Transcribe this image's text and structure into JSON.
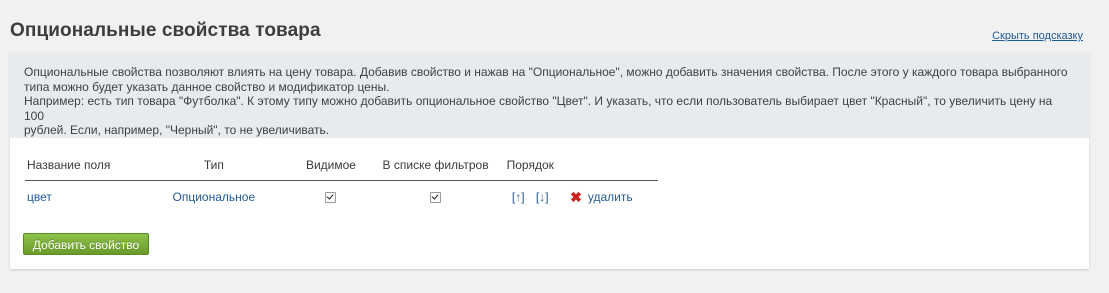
{
  "header": {
    "title": "Опциональные свойства товара",
    "hide_hint": "Скрыть подсказку"
  },
  "hint": {
    "line1": "Опциональные свойства позволяют влиять на цену товара. Добавив свойство и нажав на \"Опциональное\", можно добавить значения свойства. После этого у каждого товара выбранного",
    "line2": "типа можно будет указать данное свойство и модификатор цены.",
    "line3": "Например: есть тип товара \"Футболка\". К этому типу можно добавить опциональное свойство \"Цвет\". И указать, что если пользователь выбирает цвет \"Красный\", то увеличить цену на 100",
    "line4": "рублей. Если, например, \"Черный\", то не увеличивать."
  },
  "table": {
    "columns": [
      "Название поля",
      "Тип",
      "Видимое",
      "В списке фильтров",
      "Порядок"
    ],
    "rows": [
      {
        "name": "цвет",
        "type": "Опциональное",
        "visible": true,
        "in_filters": true,
        "order_up": "[↑]",
        "order_down": "[↓]",
        "delete": "удалить"
      }
    ]
  },
  "actions": {
    "add_property": "Добавить свойство"
  },
  "icons": {
    "delete": "close-icon",
    "checkbox": "checkbox-checked"
  },
  "colors": {
    "link": "#1f5a95",
    "button": "#7bb03a",
    "hint_background": "#e7ebee",
    "delete_icon": "#c8201c"
  }
}
